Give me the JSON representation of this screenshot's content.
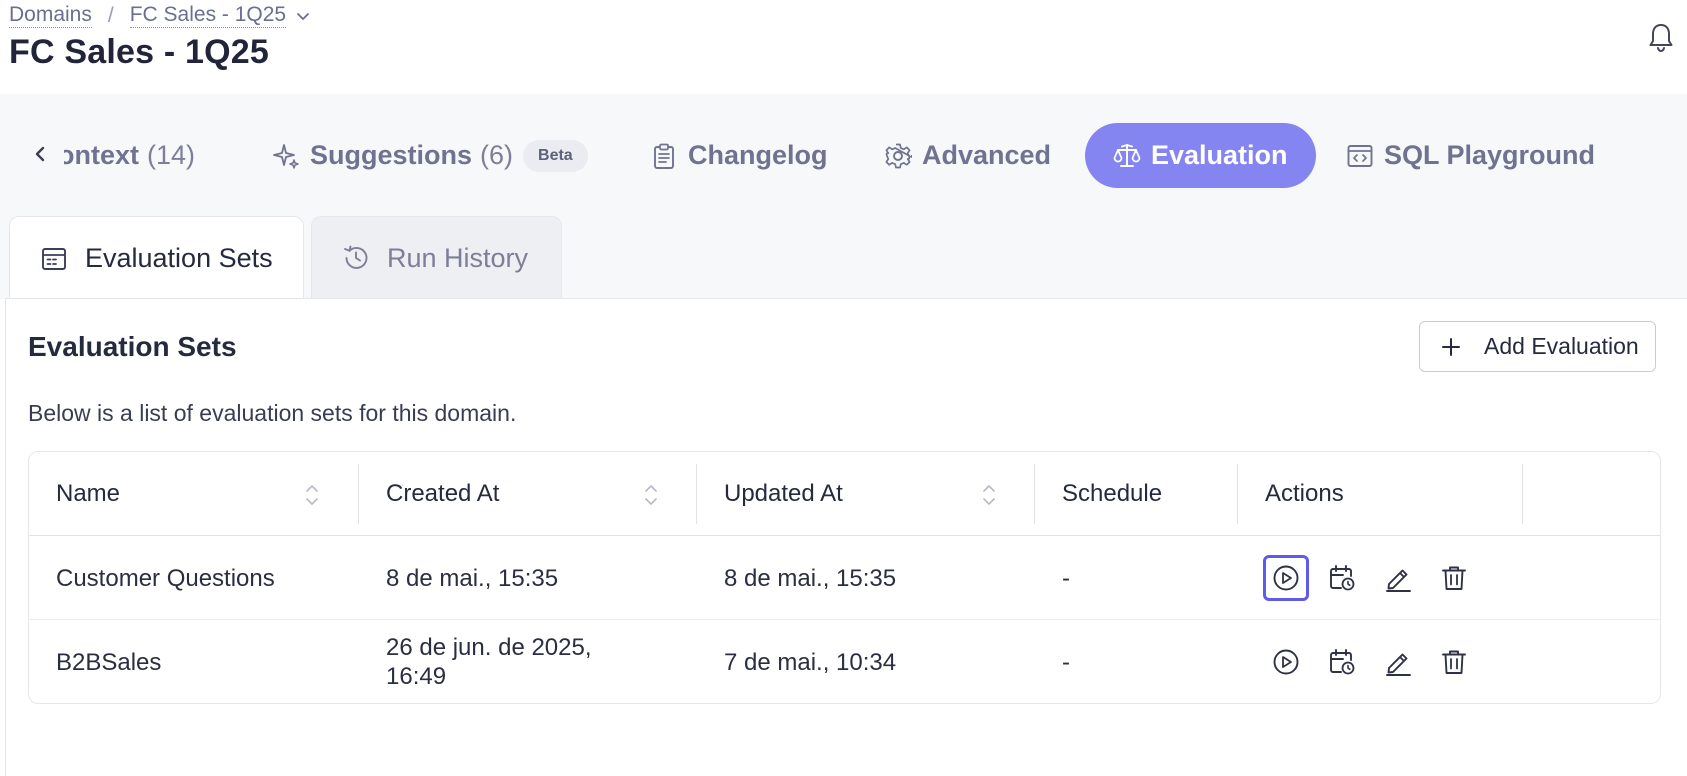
{
  "breadcrumb": {
    "root": "Domains",
    "separator": "/",
    "current": "FC Sales - 1Q25"
  },
  "page": {
    "title": "FC Sales - 1Q25"
  },
  "domain_tabs": [
    {
      "label": "Context",
      "visible_label": "ontext",
      "count": "(14)",
      "icon": "context-icon"
    },
    {
      "label": "Suggestions",
      "count": "(6)",
      "badge": "Beta",
      "icon": "sparkle-icon"
    },
    {
      "label": "Changelog",
      "icon": "clipboard-icon"
    },
    {
      "label": "Advanced",
      "icon": "gear-icon"
    },
    {
      "label": "Evaluation",
      "icon": "scale-icon",
      "active": true
    },
    {
      "label": "SQL Playground",
      "icon": "code-window-icon"
    }
  ],
  "sub_tabs": [
    {
      "label": "Evaluation Sets",
      "icon": "table-icon",
      "active": true
    },
    {
      "label": "Run History",
      "icon": "history-icon",
      "active": false
    }
  ],
  "section": {
    "title": "Evaluation Sets",
    "description": "Below is a list of evaluation sets for this domain.",
    "add_button_label": "Add Evaluation"
  },
  "table": {
    "columns": [
      "Name",
      "Created At",
      "Updated At",
      "Schedule",
      "Actions"
    ],
    "rows": [
      {
        "name": "Customer Questions",
        "created_at": "8 de mai., 15:35",
        "updated_at": "8 de mai., 15:35",
        "schedule": "-"
      },
      {
        "name": "B2BSales",
        "created_at_line1": "26 de jun. de 2025,",
        "created_at_line2": "16:49",
        "updated_at": "7 de mai., 10:34",
        "schedule": "-"
      }
    ],
    "row_actions": [
      "run-icon",
      "schedule-icon",
      "edit-icon",
      "delete-icon"
    ]
  },
  "colors": {
    "accent": "#8585f2",
    "focus_ring": "#5f5bea",
    "muted_text": "#6f7390",
    "tabbar_bg": "#f7f8fa"
  }
}
